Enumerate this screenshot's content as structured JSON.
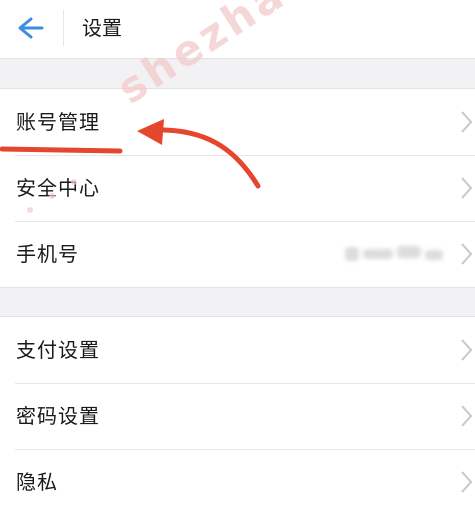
{
  "header": {
    "title": "设置",
    "back_icon": "arrow-left-icon"
  },
  "groups": [
    {
      "items": [
        {
          "label": "账号管理",
          "icon": "chevron-right-icon"
        },
        {
          "label": "安全中心",
          "icon": "chevron-right-icon"
        },
        {
          "label": "手机号",
          "icon": "chevron-right-icon"
        }
      ]
    },
    {
      "items": [
        {
          "label": "支付设置",
          "icon": "chevron-right-icon"
        },
        {
          "label": "密码设置",
          "icon": "chevron-right-icon"
        },
        {
          "label": "隐私",
          "icon": "chevron-right-icon"
        }
      ]
    }
  ],
  "watermark": {
    "text": "shezha"
  },
  "colors": {
    "accent": "#3a8ee6",
    "annotation": "#e5472e",
    "watermark": "#f3c9c9",
    "background": "#f2f2f4",
    "chevron": "#c7c7cc"
  }
}
